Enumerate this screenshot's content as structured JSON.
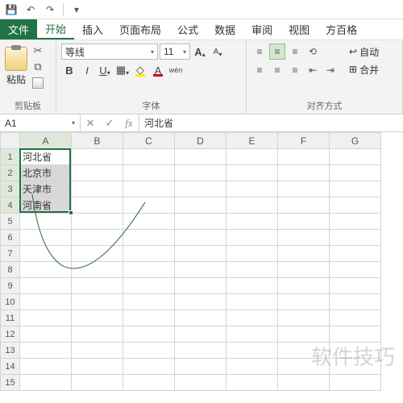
{
  "qat": {
    "save": "💾",
    "undo": "↶",
    "redo": "↷",
    "more": "▾"
  },
  "tabs": {
    "file": "文件",
    "items": [
      "开始",
      "插入",
      "页面布局",
      "公式",
      "数据",
      "审阅",
      "视图",
      "方百格"
    ],
    "active": 0
  },
  "ribbon": {
    "clipboard": {
      "paste": "粘贴",
      "label": "剪贴板"
    },
    "font": {
      "name": "等线",
      "size": "11",
      "bold": "B",
      "italic": "I",
      "underline": "U",
      "increase": "A",
      "decrease": "A",
      "wen": "wén",
      "label": "字体"
    },
    "align": {
      "wrap": "自动",
      "merge": "合并",
      "label": "对齐方式"
    }
  },
  "nameBox": "A1",
  "formula": "河北省",
  "columns": [
    "A",
    "B",
    "C",
    "D",
    "E",
    "F",
    "G"
  ],
  "rows": [
    "1",
    "2",
    "3",
    "4",
    "5",
    "6",
    "7",
    "8",
    "9",
    "10",
    "11",
    "12",
    "13",
    "14",
    "15"
  ],
  "cells": {
    "A1": "河北省",
    "A2": "北京市",
    "A3": "天津市",
    "A4": "河南省"
  },
  "selection": {
    "col": "A",
    "rows": [
      1,
      2,
      3,
      4
    ],
    "active": "A1"
  },
  "watermark": "软件技巧"
}
